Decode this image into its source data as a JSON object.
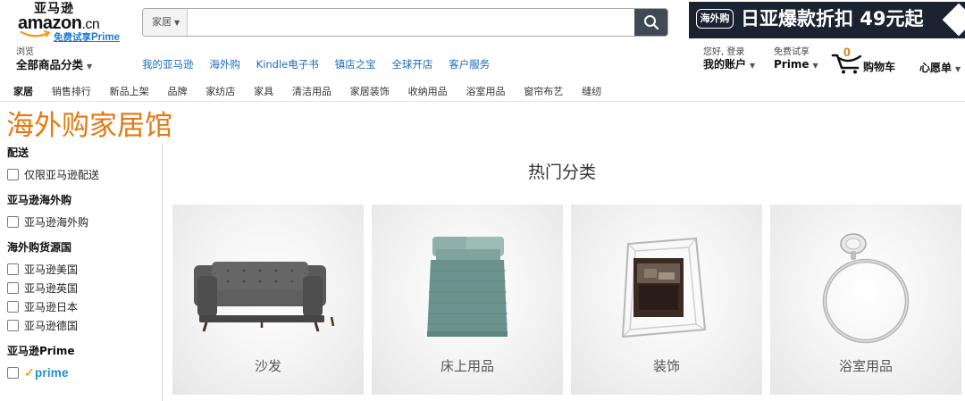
{
  "logo": {
    "cn_text": "亚马逊",
    "en_text": "amazon",
    "en_suffix": ".cn",
    "trial_text": "免费试享",
    "trial_brand": "Prime"
  },
  "search": {
    "category": "家居",
    "value": "",
    "placeholder": "",
    "button_icon": "search-icon"
  },
  "promo": {
    "badge": "海外购",
    "text": "日亚爆款折扣 49元起"
  },
  "nav": {
    "browse_small": "浏览",
    "browse_big": "全部商品分类",
    "links": [
      "我的亚马逊",
      "海外购",
      "Kindle电子书",
      "镇店之宝",
      "全球开店",
      "客户服务"
    ],
    "account_small": "您好, 登录",
    "account_big": "我的账户",
    "prime_small": "免费试享",
    "prime_big": "Prime",
    "cart_count": "0",
    "cart_label": "购物车",
    "wishlist": "心愿单"
  },
  "subnav": {
    "items": [
      "家居",
      "销售排行",
      "新品上架",
      "品牌",
      "家纺店",
      "家具",
      "清洁用品",
      "家居装饰",
      "收纳用品",
      "浴室用品",
      "窗帘布艺",
      "缝纫"
    ]
  },
  "page_title": "海外购家居馆",
  "filters": {
    "groups": [
      {
        "title": "配送",
        "options": [
          "仅限亚马逊配送"
        ]
      },
      {
        "title": "亚马逊海外购",
        "options": [
          "亚马逊海外购"
        ]
      },
      {
        "title": "海外购货源国",
        "options": [
          "亚马逊美国",
          "亚马逊英国",
          "亚马逊日本",
          "亚马逊德国"
        ]
      },
      {
        "title": "亚马逊Prime",
        "options": [
          "prime"
        ]
      }
    ]
  },
  "hot": {
    "title": "热门分类",
    "categories": [
      {
        "label": "沙发",
        "icon": "sofa-image"
      },
      {
        "label": "床上用品",
        "icon": "bedding-image"
      },
      {
        "label": "装饰",
        "icon": "photo-frame-image"
      },
      {
        "label": "浴室用品",
        "icon": "towel-ring-image"
      }
    ]
  },
  "colors": {
    "accent_orange": "#e47911",
    "link_blue": "#1a6bbf",
    "promo_bg": "#1b2230",
    "search_btn": "#404a56"
  }
}
